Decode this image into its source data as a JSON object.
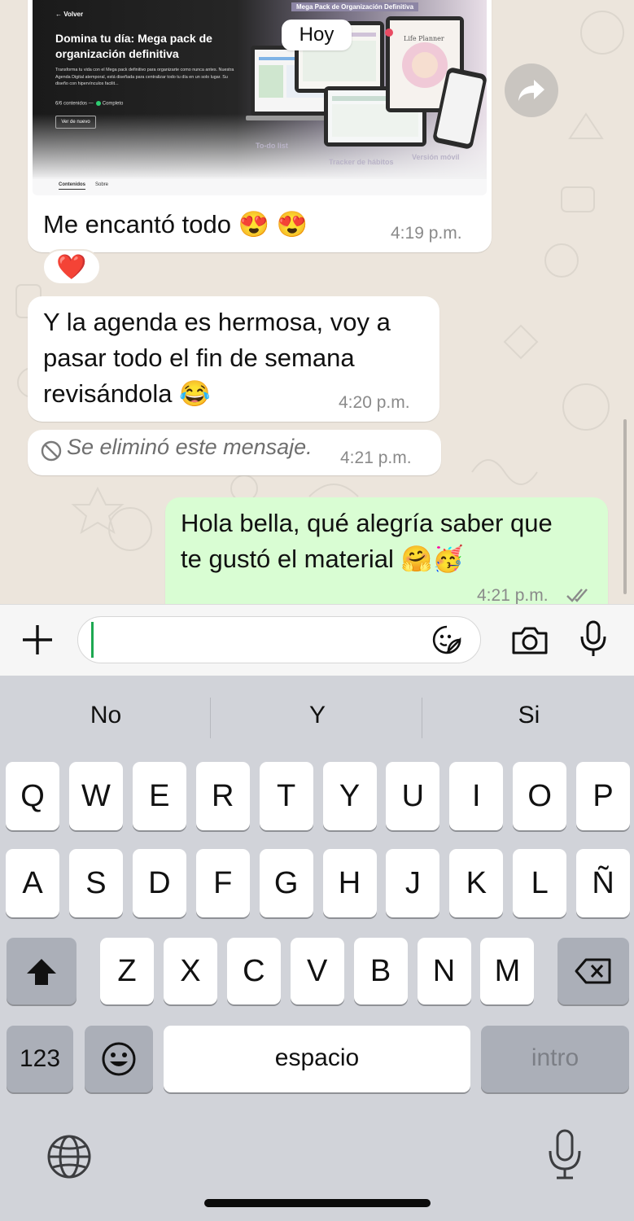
{
  "date_chip": "Hoy",
  "link_preview": {
    "back_label": "← Volver",
    "title": "Domina tu día: Mega pack de organización definitiva",
    "description": "Transforma tu vida con el Mega pack definitivo para organizarte como nunca antes. Nuestra Agenda Digital atemporal, está diseñada para centralizar todo tu día en un solo lugar. Su diseño con hipervínculos facilit...",
    "progress": "6/6 contenidos —",
    "status": "Completo",
    "button": "Ver de nuevo",
    "tabs": [
      "Contenidos",
      "Sobre"
    ],
    "pack_banner": "Mega Pack de Organización Definitiva",
    "tag_todo": "To-do list",
    "tag_tracker": "Tracker de hábitos",
    "tag_version": "Versión móvil",
    "planner_label": "Life Planner"
  },
  "messages": [
    {
      "text": "Me encantó todo 😍 😍",
      "time": "4:19 p.m.",
      "reaction": "❤️"
    },
    {
      "lines": [
        "Y la agenda es hermosa, voy a",
        "pasar todo el fin de semana",
        "revisándola 😂"
      ],
      "time": "4:20 p.m."
    },
    {
      "text": "Se eliminó este mensaje.",
      "time": "4:21 p.m."
    },
    {
      "lines": [
        "Hola bella, qué alegría saber que",
        "te gustó el material 🤗🥳"
      ],
      "time": "4:21 p.m."
    }
  ],
  "input": {
    "value": ""
  },
  "keyboard": {
    "suggestions": [
      "No",
      "Y",
      "Si"
    ],
    "row1": [
      "Q",
      "W",
      "E",
      "R",
      "T",
      "Y",
      "U",
      "I",
      "O",
      "P"
    ],
    "row2": [
      "A",
      "S",
      "D",
      "F",
      "G",
      "H",
      "J",
      "K",
      "L",
      "Ñ"
    ],
    "row3": [
      "Z",
      "X",
      "C",
      "V",
      "B",
      "N",
      "M"
    ],
    "numbers_key": "123",
    "space_key": "espacio",
    "return_key": "intro"
  },
  "colors": {
    "outgoing_bubble": "#d9fdd3",
    "incoming_bubble": "#ffffff",
    "caret": "#1da851",
    "chat_bg": "#ece5dc"
  },
  "icons": [
    "forward-icon",
    "deleted-icon",
    "plus-icon",
    "sticker-icon",
    "camera-icon",
    "mic-icon",
    "shift-icon",
    "backspace-icon",
    "emoji-icon",
    "globe-icon",
    "dictation-icon",
    "double-check-icon"
  ]
}
